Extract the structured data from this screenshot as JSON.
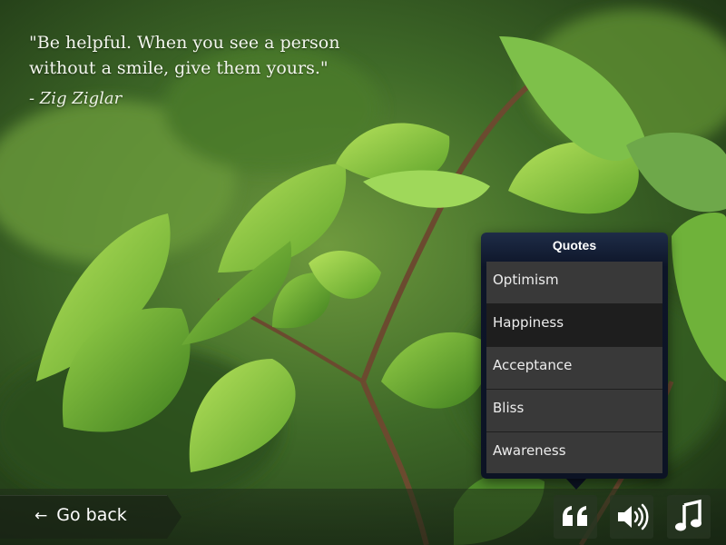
{
  "quote": {
    "text": "\"Be helpful. When you see a person without a smile, give them yours.\"",
    "author": "- Zig Ziglar"
  },
  "popover": {
    "title": "Quotes",
    "items": [
      {
        "label": "Optimism"
      },
      {
        "label": "Happiness",
        "selected": true
      },
      {
        "label": "Acceptance"
      },
      {
        "label": "Bliss"
      },
      {
        "label": "Awareness"
      }
    ]
  },
  "bottom_bar": {
    "back_label": "Go back",
    "buttons": [
      {
        "name": "quotes-icon"
      },
      {
        "name": "volume-icon"
      },
      {
        "name": "music-note-icon"
      }
    ]
  },
  "colors": {
    "popover_bg": "#0c1324",
    "item_bg": "#393939",
    "item_selected_bg": "#1e1e1e"
  }
}
